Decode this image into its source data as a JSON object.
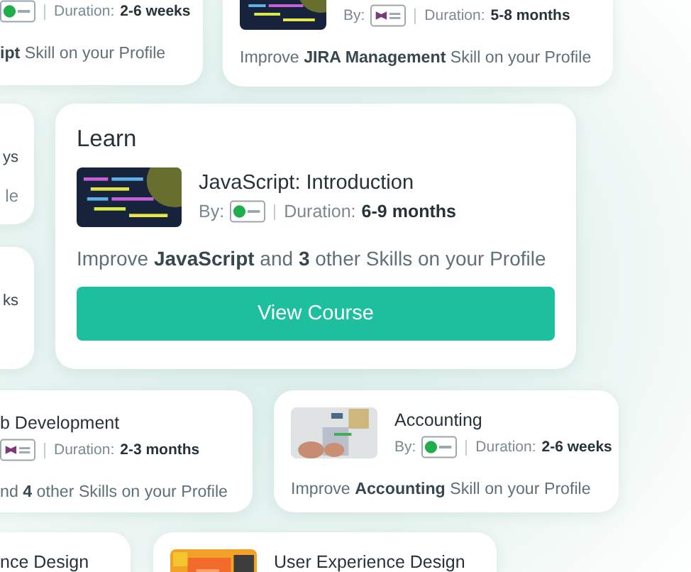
{
  "cards": [
    {
      "kind": "compact",
      "logo": {
        "kind": "round"
      },
      "duration_label": "Duration:",
      "duration": "2-6 weeks",
      "skill": "**ipt** Skill on your Profile"
    },
    {
      "kind": "compact",
      "by_label": "By:",
      "logo": {
        "kind": "wings"
      },
      "duration_label": "Duration:",
      "duration": "5-8 months",
      "skill": "Improve **JIRA Management** Skill on your Profile"
    },
    {
      "kind": "sliver",
      "lines": [
        {
          "text": "ys",
          "kind": "strong"
        },
        {
          "text": "le",
          "kind": "muted"
        }
      ]
    },
    {
      "kind": "sliver",
      "lines": [
        {
          "text": "ks",
          "kind": "strong"
        }
      ]
    },
    {
      "kind": "featured",
      "heading": "Learn",
      "title": "JavaScript: Introduction",
      "by_label": "By:",
      "logo": {
        "kind": "round"
      },
      "duration_label": "Duration:",
      "duration": "6-9 months",
      "skill": "Improve **JavaScript** and **3** other Skills on your Profile",
      "button": "View Course"
    },
    {
      "kind": "compact",
      "title": "b Development",
      "logo": {
        "kind": "wings"
      },
      "duration_label": "Duration:",
      "duration": "2-3 months",
      "skill": "nd **4** other Skills on your Profile"
    },
    {
      "kind": "compact",
      "title": "Accounting",
      "by_label": "By:",
      "logo": {
        "kind": "round"
      },
      "duration_label": "Duration:",
      "duration": "2-6 weeks",
      "skill": "Improve **Accounting** Skill on your Profile"
    },
    {
      "kind": "compact",
      "title": "nce Design"
    },
    {
      "kind": "compact",
      "title": "User Experience Design"
    }
  ]
}
